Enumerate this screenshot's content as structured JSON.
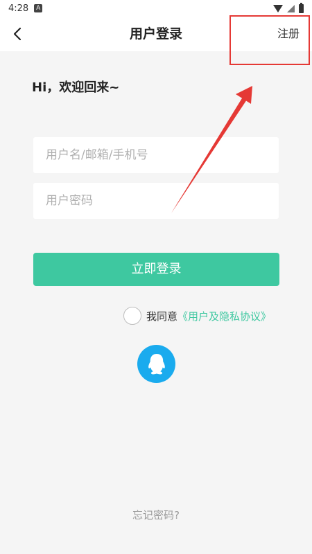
{
  "status_bar": {
    "time": "4:28",
    "app_icon": "A"
  },
  "navbar": {
    "back_icon": "chevron-left-icon",
    "title": "用户登录",
    "register_label": "注册"
  },
  "greeting": "Hi，欢迎回来~",
  "form": {
    "username_placeholder": "用户名/邮箱/手机号",
    "password_placeholder": "用户密码",
    "login_button": "立即登录"
  },
  "agreement": {
    "prefix": "我同意",
    "link": "《用户及隐私协议》",
    "checked": false
  },
  "social": {
    "qq_icon": "qq-penguin-icon"
  },
  "forgot_password": "忘记密码?",
  "colors": {
    "accent": "#3ec8a0",
    "qq": "#1aabee",
    "annotation": "#e53935",
    "background": "#f5f5f5"
  }
}
